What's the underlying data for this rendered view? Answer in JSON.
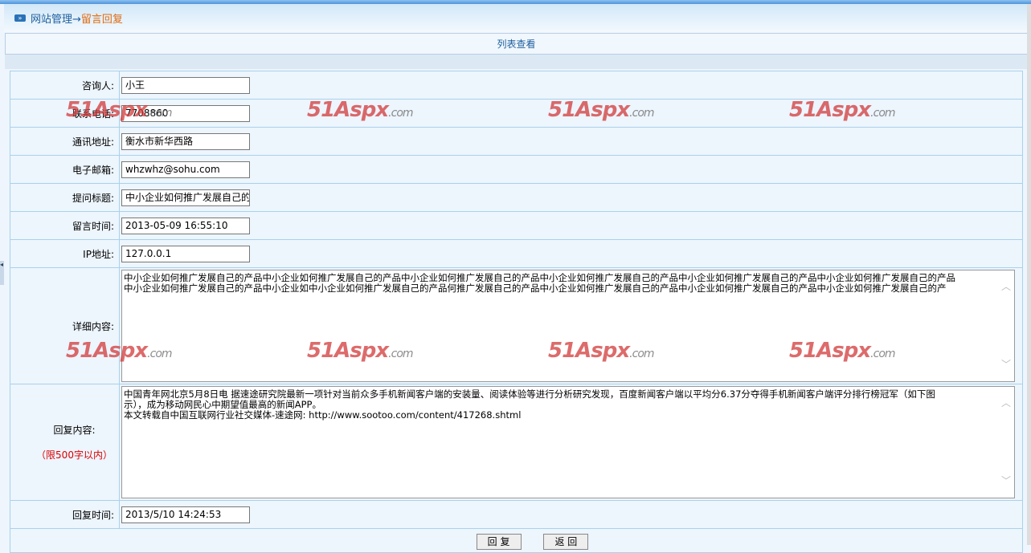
{
  "breadcrumb": {
    "root": "网站管理→",
    "current": "留言回复"
  },
  "list_view": "列表查看",
  "fields": [
    {
      "label": "咨询人:",
      "value": "小王"
    },
    {
      "label": "联系电话:",
      "value": "7708860"
    },
    {
      "label": "通讯地址:",
      "value": "衡水市新华西路"
    },
    {
      "label": "电子邮箱:",
      "value": "whzwhz@sohu.com"
    },
    {
      "label": "提问标题:",
      "value": "中小企业如何推广发展自己的产品"
    },
    {
      "label": "留言时间:",
      "value": "2013-05-09 16:55:10"
    },
    {
      "label": "IP地址:",
      "value": "127.0.0.1"
    }
  ],
  "detail": {
    "label": "详细内容:",
    "line1": "中小企业如何推广发展自己的产品中小企业如何推广发展自己的产品中小企业如何推广发展自己的产品中小企业如何推广发展自己的产品中小企业如何推广发展自己的产品中小企业如何推广发展自己的产品",
    "line2": "中小企业如何推广发展自己的产品中小企业如中小企业如何推广发展自己的产品何推广发展自己的产品中小企业如何推广发展自己的产品中小企业如何推广发展自己的产品中小企业如何推广发展自己的产"
  },
  "reply": {
    "label": "回复内容:",
    "limit": "（限500字以内）",
    "line1": "中国青年网北京5月8日电 据速途研究院最新一项针对当前众多手机新闻客户端的安装量、阅读体验等进行分析研究发现，百度新闻客户端以平均分6.37分夺得手机新闻客户端评分排行榜冠军（如下图",
    "line2": "示），成为移动网民心中期望值最高的新闻APP。",
    "line3": "本文转载自中国互联网行业社交媒体-速途网: http://www.sootoo.com/content/417268.shtml"
  },
  "reply_time": {
    "label": "回复时间:",
    "value": "2013/5/10 14:24:53"
  },
  "buttons": {
    "submit": "回 复",
    "back": "返 回"
  },
  "watermark": "51Aspx.com"
}
